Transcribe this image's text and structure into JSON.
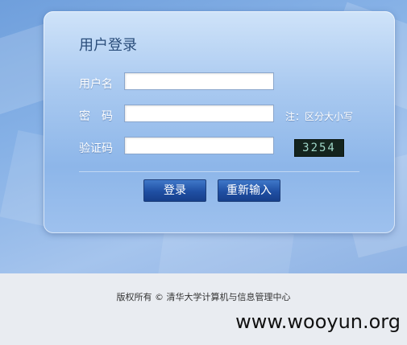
{
  "login": {
    "title": "用户登录",
    "username_label": "用户名",
    "password_label": "密　码",
    "captcha_label": "验证码",
    "password_hint": "注：区分大小写",
    "captcha_code": "3254",
    "login_button": "登录",
    "reset_button": "重新输入",
    "username_value": "",
    "password_value": "",
    "captcha_value": ""
  },
  "footer": {
    "copyright": "版权所有 © 清华大学计算机与信息管理中心"
  },
  "watermark": "www.wooyun.org",
  "colors": {
    "panel_accent": "#8db6e9",
    "button": "#1f4fa3",
    "title": "#2a4d7a"
  }
}
